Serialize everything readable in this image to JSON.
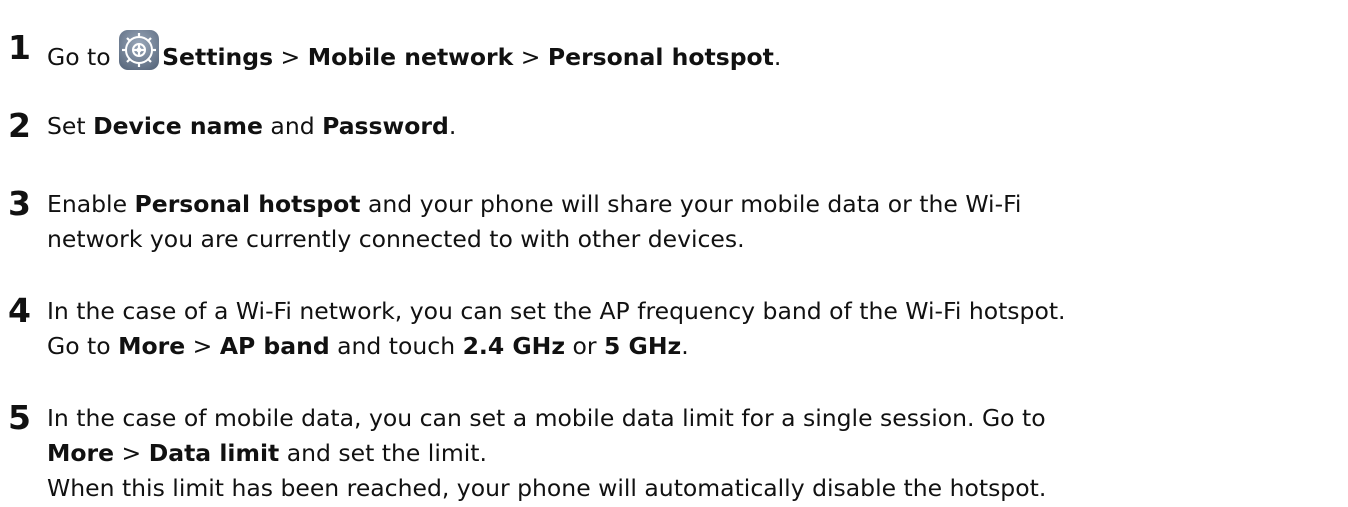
{
  "steps": [
    {
      "number": "1",
      "lines": [
        [
          {
            "t": "Go to ",
            "b": false
          },
          {
            "icon": "settings-gear-icon"
          },
          {
            "t": "Settings",
            "b": true
          },
          {
            "t": " > ",
            "b": false
          },
          {
            "t": "Mobile network",
            "b": true
          },
          {
            "t": " > ",
            "b": false
          },
          {
            "t": "Personal hotspot",
            "b": true
          },
          {
            "t": ".",
            "b": false
          }
        ]
      ]
    },
    {
      "number": "2",
      "lines": [
        [
          {
            "t": "Set ",
            "b": false
          },
          {
            "t": "Device name",
            "b": true
          },
          {
            "t": " and ",
            "b": false
          },
          {
            "t": "Password",
            "b": true
          },
          {
            "t": ".",
            "b": false
          }
        ]
      ]
    },
    {
      "number": "3",
      "lines": [
        [
          {
            "t": "Enable ",
            "b": false
          },
          {
            "t": "Personal hotspot",
            "b": true
          },
          {
            "t": " and your phone will share your mobile data or the Wi-Fi",
            "b": false
          }
        ],
        [
          {
            "t": "network you are currently connected to with other devices.",
            "b": false
          }
        ]
      ]
    },
    {
      "number": "4",
      "lines": [
        [
          {
            "t": "In the case of a Wi-Fi network, you can set the AP frequency band of the Wi-Fi hotspot.",
            "b": false
          }
        ],
        [
          {
            "t": "Go to ",
            "b": false
          },
          {
            "t": "More",
            "b": true
          },
          {
            "t": " > ",
            "b": false
          },
          {
            "t": "AP band",
            "b": true
          },
          {
            "t": " and touch ",
            "b": false
          },
          {
            "t": "2.4 GHz",
            "b": true
          },
          {
            "t": " or ",
            "b": false
          },
          {
            "t": "5 GHz",
            "b": true
          },
          {
            "t": ".",
            "b": false
          }
        ]
      ]
    },
    {
      "number": "5",
      "lines": [
        [
          {
            "t": "In the case of mobile data, you can set a mobile data limit for a single session. Go to",
            "b": false
          }
        ],
        [
          {
            "t": "More",
            "b": true
          },
          {
            "t": " > ",
            "b": false
          },
          {
            "t": "Data limit",
            "b": true
          },
          {
            "t": " and set the limit.",
            "b": false
          }
        ],
        [
          {
            "t": "When this limit has been reached, your phone will automatically disable the hotspot.",
            "b": false
          }
        ]
      ]
    }
  ]
}
